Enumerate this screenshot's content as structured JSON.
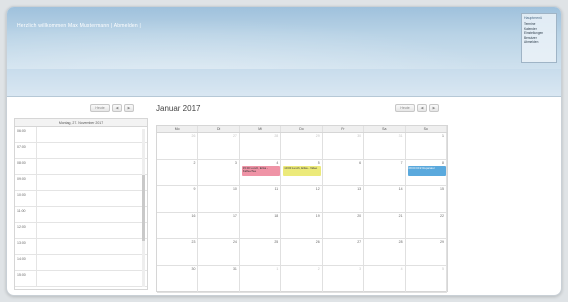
{
  "header": {
    "welcome_text": "Herzlich willkommen Max Mustermann | Abmelden |",
    "menu_title": "Hauptmenü",
    "menu_items": [
      "Termine",
      "Kalender",
      "Einstellungen",
      "Benutzer",
      "Abmelden"
    ]
  },
  "day_view": {
    "today_label": "Heute",
    "prev_label": "◀",
    "next_label": "▶",
    "date_title": "Montag, 27. November 2017",
    "times": [
      "06:00",
      "07:00",
      "08:00",
      "09:00",
      "10:00",
      "11:00",
      "12:00",
      "13:00",
      "14:00",
      "15:00"
    ]
  },
  "month_view": {
    "title": "Januar 2017",
    "today_label": "Heute",
    "prev_label": "◀",
    "next_label": "▶",
    "weekdays": [
      "Mo",
      "Di",
      "Mi",
      "Do",
      "Fr",
      "Sa",
      "So"
    ],
    "weeks": [
      [
        {
          "d": "26",
          "o": true
        },
        {
          "d": "27",
          "o": true
        },
        {
          "d": "28",
          "o": true
        },
        {
          "d": "29",
          "o": true
        },
        {
          "d": "30",
          "o": true
        },
        {
          "d": "31",
          "o": true
        },
        {
          "d": "1",
          "o": false
        }
      ],
      [
        {
          "d": "2",
          "o": false
        },
        {
          "d": "3",
          "o": false
        },
        {
          "d": "4",
          "o": false
        },
        {
          "d": "5",
          "o": false
        },
        {
          "d": "6",
          "o": false
        },
        {
          "d": "7",
          "o": false
        },
        {
          "d": "8",
          "o": false
        }
      ],
      [
        {
          "d": "9",
          "o": false
        },
        {
          "d": "10",
          "o": false
        },
        {
          "d": "11",
          "o": false
        },
        {
          "d": "12",
          "o": false
        },
        {
          "d": "13",
          "o": false
        },
        {
          "d": "14",
          "o": false
        },
        {
          "d": "15",
          "o": false
        }
      ],
      [
        {
          "d": "16",
          "o": false
        },
        {
          "d": "17",
          "o": false
        },
        {
          "d": "18",
          "o": false
        },
        {
          "d": "19",
          "o": false
        },
        {
          "d": "20",
          "o": false
        },
        {
          "d": "21",
          "o": false
        },
        {
          "d": "22",
          "o": false
        }
      ],
      [
        {
          "d": "23",
          "o": false
        },
        {
          "d": "24",
          "o": false
        },
        {
          "d": "25",
          "o": false
        },
        {
          "d": "26",
          "o": false
        },
        {
          "d": "27",
          "o": false
        },
        {
          "d": "28",
          "o": false
        },
        {
          "d": "29",
          "o": false
        }
      ],
      [
        {
          "d": "30",
          "o": false
        },
        {
          "d": "31",
          "o": false
        },
        {
          "d": "1",
          "o": true
        },
        {
          "d": "2",
          "o": true
        },
        {
          "d": "3",
          "o": true
        },
        {
          "d": "4",
          "o": true
        },
        {
          "d": "5",
          "o": true
        }
      ]
    ],
    "events": [
      {
        "week": 1,
        "day": 2,
        "text": "15:00 Lunch, Erika - Kaffee/Tee",
        "color": "#ef93a6"
      },
      {
        "week": 1,
        "day": 3,
        "text": "10:00 Lunch, Erika - Video",
        "color": "#ecea7a"
      },
      {
        "week": 1,
        "day": 6,
        "text": "08:00 KFZ Reparatur",
        "color": "#5aa9dd"
      }
    ]
  },
  "colors": {
    "banner_top": "#9fc1dc",
    "event_pink": "#ef93a6",
    "event_yellow": "#ecea7a",
    "event_blue": "#5aa9dd"
  }
}
